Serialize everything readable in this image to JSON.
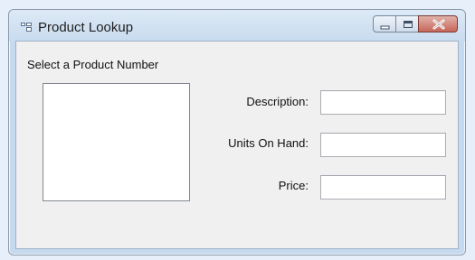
{
  "window": {
    "title": "Product Lookup"
  },
  "form": {
    "list_label": "Select a Product Number",
    "list_items": [],
    "description_label": "Description:",
    "description_value": "",
    "units_label": "Units On Hand:",
    "units_value": "",
    "price_label": "Price:",
    "price_value": ""
  },
  "icons": {
    "app": "form-icon",
    "minimize": "minimize-icon",
    "maximize": "maximize-icon",
    "close": "close-icon"
  },
  "colors": {
    "titlebar": "#c8dbef",
    "client": "#f0f0f0",
    "close_button": "#c7665a"
  }
}
